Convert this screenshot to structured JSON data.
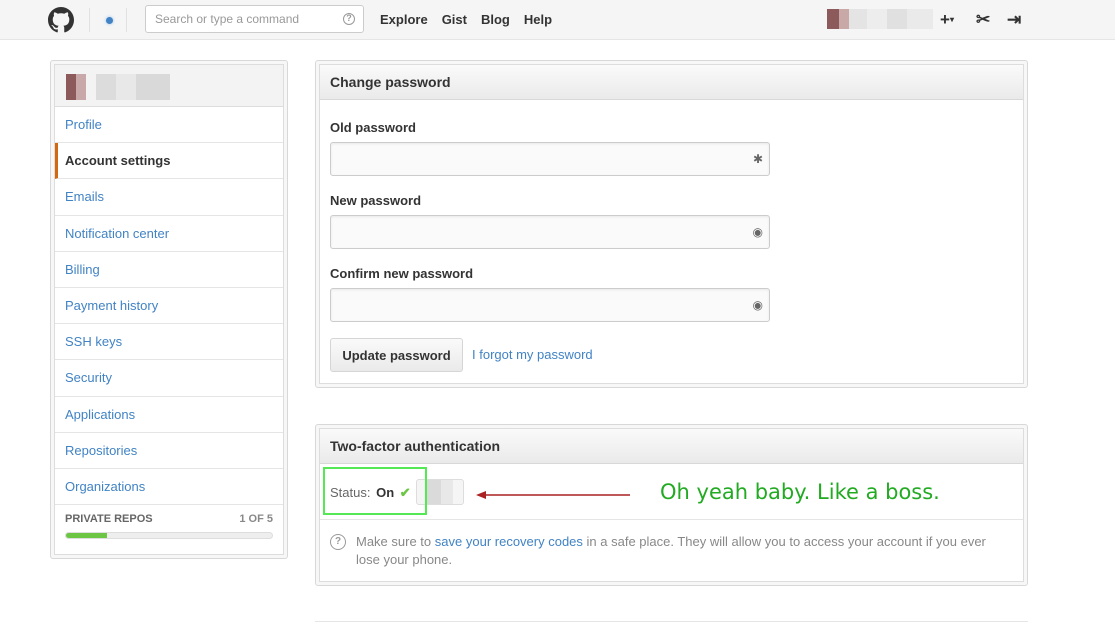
{
  "header": {
    "search_placeholder": "Search or type a command",
    "nav": [
      "Explore",
      "Gist",
      "Blog",
      "Help"
    ],
    "plus_icon": "+",
    "tools_icon": "✂",
    "signout_icon": "⇥"
  },
  "sidebar": {
    "items": [
      {
        "label": "Profile",
        "selected": false
      },
      {
        "label": "Account settings",
        "selected": true
      },
      {
        "label": "Emails",
        "selected": false
      },
      {
        "label": "Notification center",
        "selected": false
      },
      {
        "label": "Billing",
        "selected": false
      },
      {
        "label": "Payment history",
        "selected": false
      },
      {
        "label": "SSH keys",
        "selected": false
      },
      {
        "label": "Security",
        "selected": false
      },
      {
        "label": "Applications",
        "selected": false
      },
      {
        "label": "Repositories",
        "selected": false
      },
      {
        "label": "Organizations",
        "selected": false
      }
    ],
    "private_repos_label": "PRIVATE REPOS",
    "private_repos_count": "1 OF 5",
    "private_repos_fraction": 0.2
  },
  "change_password": {
    "title": "Change password",
    "old_label": "Old password",
    "new_label": "New password",
    "confirm_label": "Confirm new password",
    "update_button": "Update password",
    "forgot_link": "I forgot my password"
  },
  "two_factor": {
    "title": "Two-factor authentication",
    "status_label": "Status:",
    "status_value": "On",
    "check_icon": "✔",
    "note_before": "Make sure to",
    "note_link": "save your recovery codes",
    "note_after": "in a safe place. They will allow you to access your account if you ever lose your phone."
  },
  "annotation": {
    "text": "Oh yeah baby. Like a boss.",
    "color": "#22aa22",
    "arrow_color": "#aa2222"
  }
}
